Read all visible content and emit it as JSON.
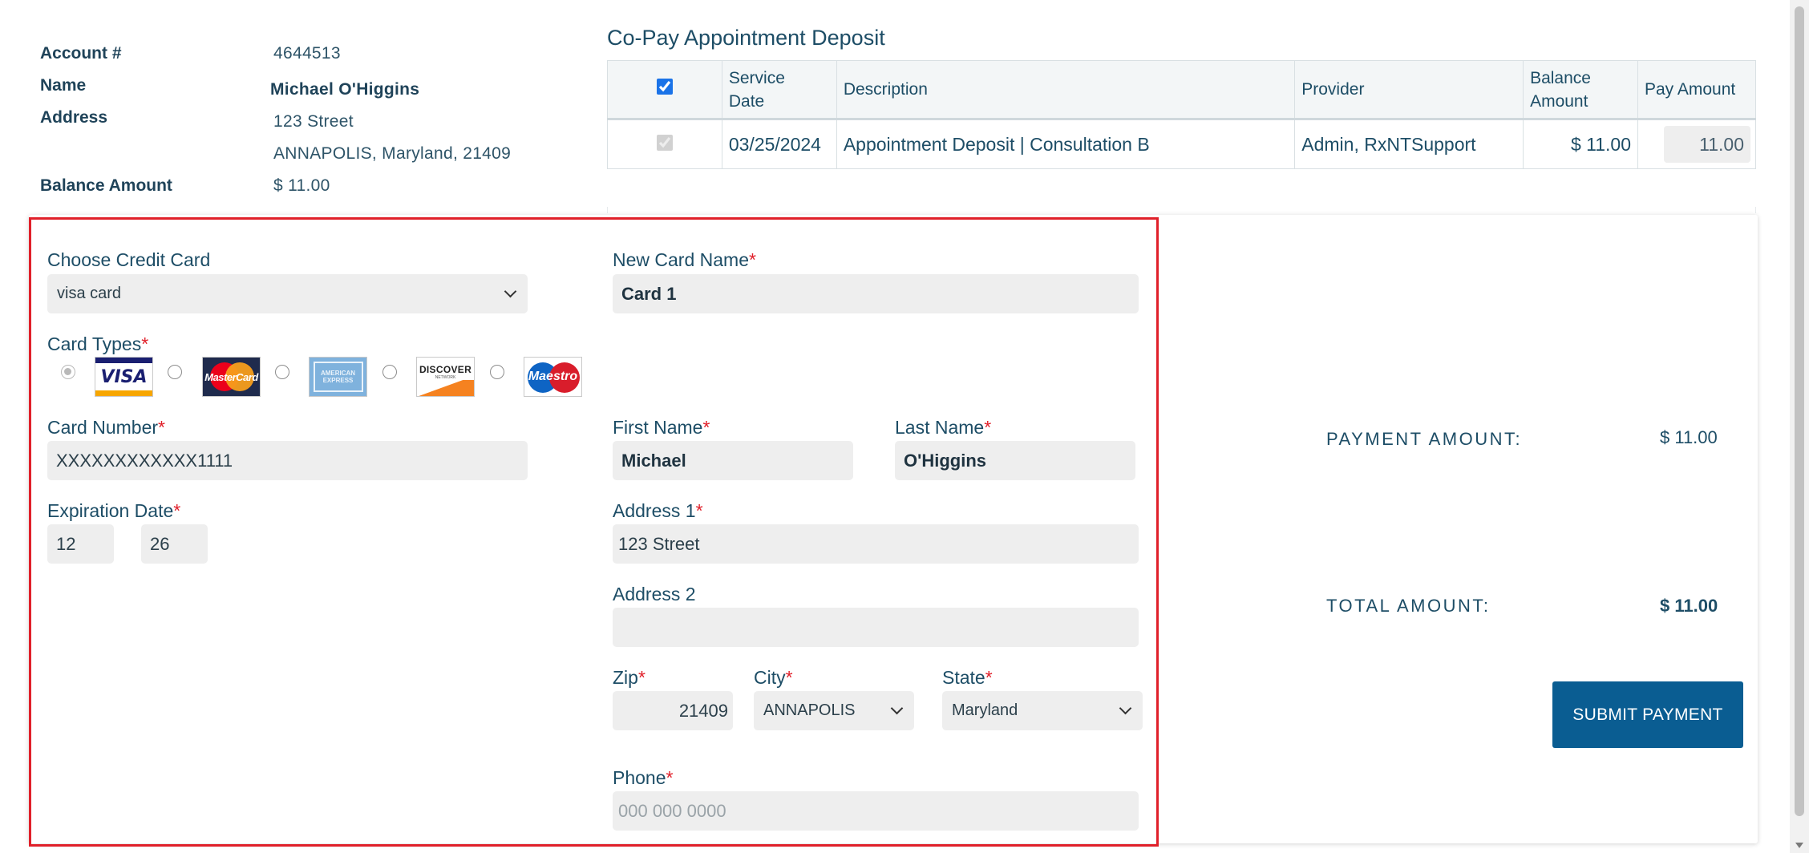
{
  "account": {
    "account_label": "Account #",
    "account_value": "4644513",
    "name_label": "Name",
    "name_value": "Michael O'Higgins",
    "address_label": "Address",
    "address_line1": "123 Street",
    "address_line2": "ANNAPOLIS, Maryland, 21409",
    "balance_label": "Balance Amount",
    "balance_value": "$ 11.00"
  },
  "deposit": {
    "title": "Co-Pay Appointment Deposit",
    "headers": {
      "service_date_1": "Service",
      "service_date_2": "Date",
      "description": "Description",
      "provider": "Provider",
      "balance_amount_1": "Balance",
      "balance_amount_2": "Amount",
      "pay_amount": "Pay Amount"
    },
    "rows": [
      {
        "service_date": "03/25/2024",
        "description": "Appointment Deposit | Consultation B",
        "provider": "Admin, RxNTSupport",
        "balance_amount": "$ 11.00",
        "pay_amount": "11.00"
      }
    ]
  },
  "card_form": {
    "choose_card_label": "Choose Credit Card",
    "choose_card_value": "visa card",
    "new_card_name_label": "New Card Name",
    "new_card_name_value": "Card 1",
    "card_types_label": "Card Types",
    "card_types": [
      "VISA",
      "MasterCard",
      "AMERICAN EXPRESS",
      "DISCOVER",
      "Maestro"
    ],
    "discover_sub": "NETWORK",
    "card_number_label": "Card Number",
    "card_number_value": "XXXXXXXXXXXX1111",
    "expiration_label": "Expiration Date",
    "exp_month": "12",
    "exp_year": "26",
    "first_name_label": "First Name",
    "first_name_value": "Michael",
    "last_name_label": "Last Name",
    "last_name_value": "O'Higgins",
    "address1_label": "Address 1",
    "address1_value": "123 Street",
    "address2_label": "Address 2",
    "address2_value": "",
    "zip_label": "Zip",
    "zip_value": "21409",
    "city_label": "City",
    "city_value": "ANNAPOLIS",
    "state_label": "State",
    "state_value": "Maryland",
    "phone_label": "Phone",
    "phone_placeholder": "000 000 0000",
    "required_mark": "*"
  },
  "summary": {
    "payment_amount_label": "PAYMENT AMOUNT:",
    "payment_amount_value": "$ 11.00",
    "total_amount_label": "TOTAL AMOUNT:",
    "total_amount_value": "$ 11.00",
    "submit_label": "SUBMIT PAYMENT"
  },
  "colors": {
    "accent": "#0a5d92",
    "required": "#e0202a",
    "highlight_border": "#e0202a",
    "text": "#1d4d66",
    "input_bg": "#eeeeee"
  }
}
